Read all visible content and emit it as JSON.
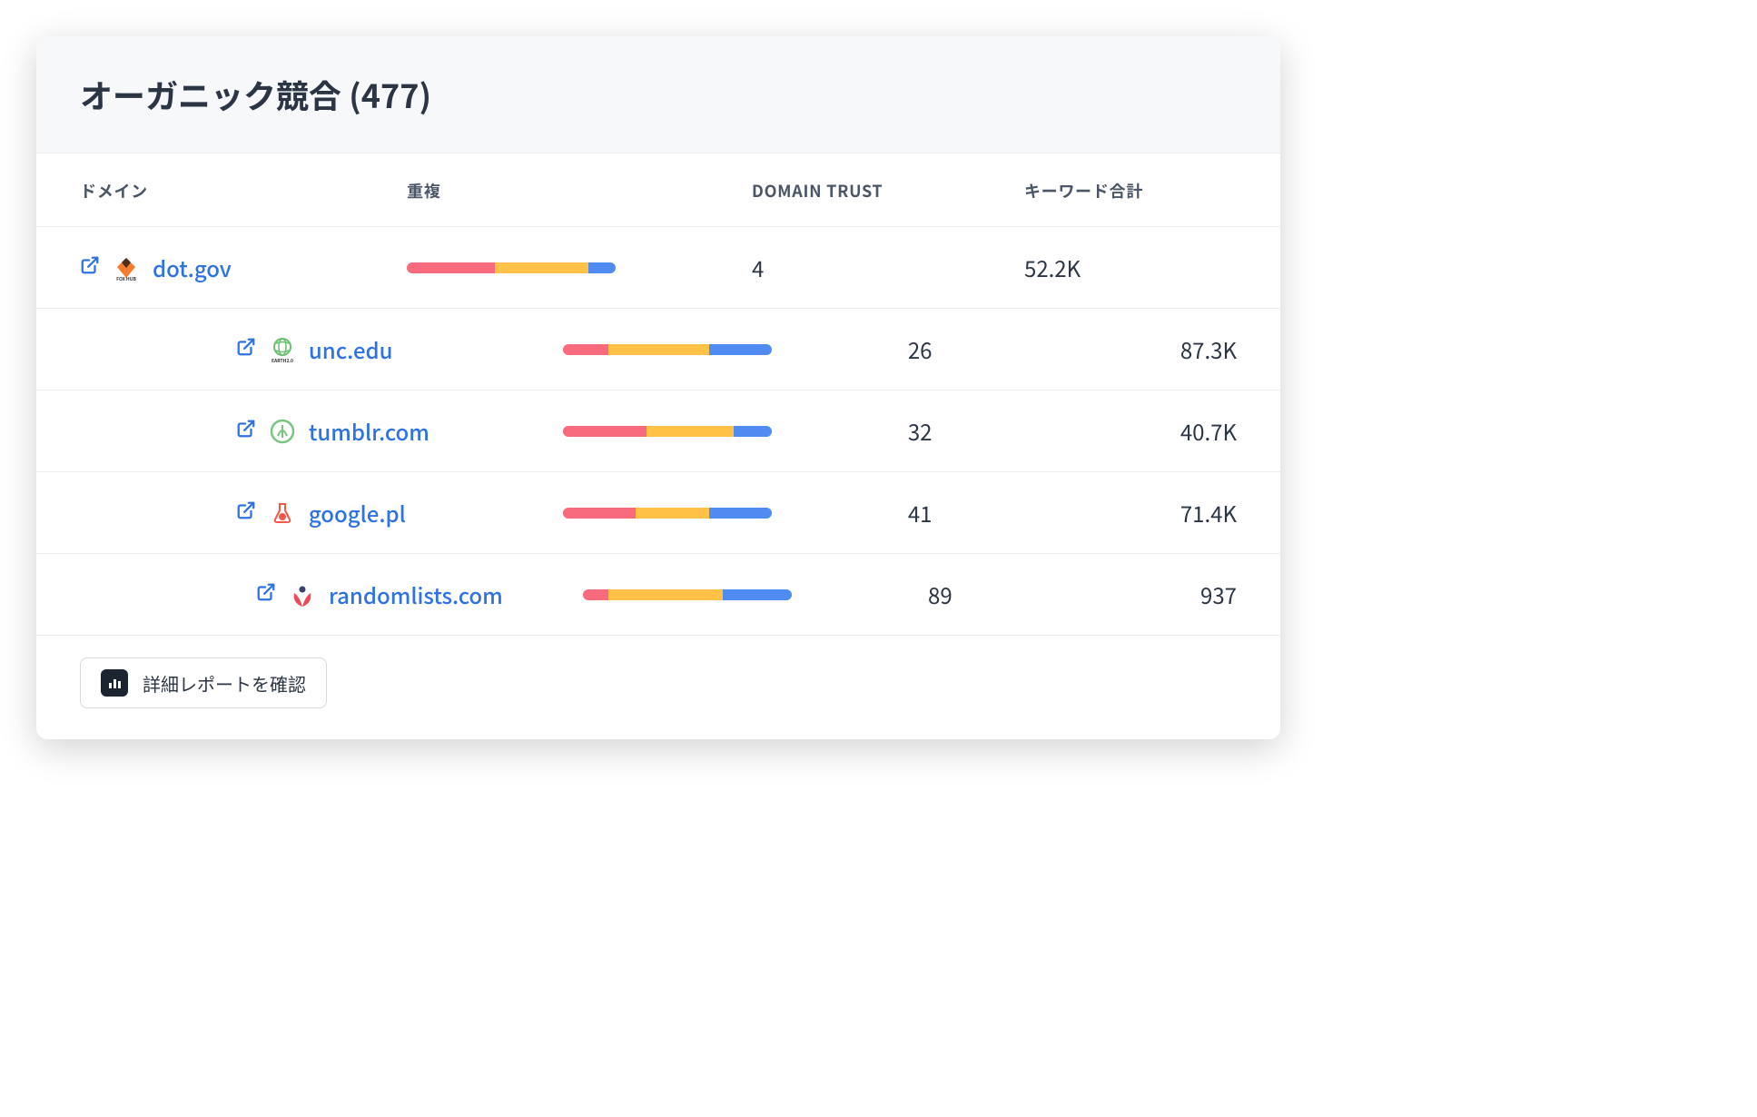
{
  "header": {
    "title_prefix": "オーガニック競合",
    "count": 477,
    "title_full": "オーガニック競合 (477)"
  },
  "columns": {
    "domain": "ドメイン",
    "overlap": "重複",
    "trust": "DOMAIN TRUST",
    "keywords": "キーワード合計"
  },
  "rows": [
    {
      "domain": "dot.gov",
      "favicon": "foxhub",
      "overlap": {
        "red": 42,
        "yellow": 45,
        "blue": 13
      },
      "trust": 4,
      "keywords": "52.2K"
    },
    {
      "domain": "unc.edu",
      "favicon": "earth2",
      "overlap": {
        "red": 22,
        "yellow": 48,
        "blue": 30
      },
      "trust": 26,
      "keywords": "87.3K"
    },
    {
      "domain": "tumblr.com",
      "favicon": "leaf-circle",
      "overlap": {
        "red": 40,
        "yellow": 42,
        "blue": 18
      },
      "trust": 32,
      "keywords": "40.7K"
    },
    {
      "domain": "google.pl",
      "favicon": "flask",
      "overlap": {
        "red": 35,
        "yellow": 35,
        "blue": 30
      },
      "trust": 41,
      "keywords": "71.4K"
    },
    {
      "domain": "randomlists.com",
      "favicon": "flower",
      "overlap": {
        "red": 12,
        "yellow": 55,
        "blue": 33
      },
      "trust": 89,
      "keywords": "937"
    }
  ],
  "footer": {
    "report_button": "詳細レポートを確認"
  },
  "colors": {
    "link": "#2f72e4",
    "bar_red": "#f86a7d",
    "bar_yellow": "#ffc247",
    "bar_blue": "#4f8bf0",
    "trust_bg": "#edeffb"
  },
  "chart_data": {
    "type": "table",
    "title": "オーガニック競合 (477)",
    "columns": [
      "ドメイン",
      "重複",
      "DOMAIN TRUST",
      "キーワード合計"
    ],
    "rows": [
      {
        "domain": "dot.gov",
        "overlap_segments": [
          42,
          45,
          13
        ],
        "domain_trust": 4,
        "total_keywords": "52.2K"
      },
      {
        "domain": "unc.edu",
        "overlap_segments": [
          22,
          48,
          30
        ],
        "domain_trust": 26,
        "total_keywords": "87.3K"
      },
      {
        "domain": "tumblr.com",
        "overlap_segments": [
          40,
          42,
          18
        ],
        "domain_trust": 32,
        "total_keywords": "40.7K"
      },
      {
        "domain": "google.pl",
        "overlap_segments": [
          35,
          35,
          30
        ],
        "domain_trust": 41,
        "total_keywords": "71.4K"
      },
      {
        "domain": "randomlists.com",
        "overlap_segments": [
          12,
          55,
          33
        ],
        "domain_trust": 89,
        "total_keywords": "937"
      }
    ]
  }
}
